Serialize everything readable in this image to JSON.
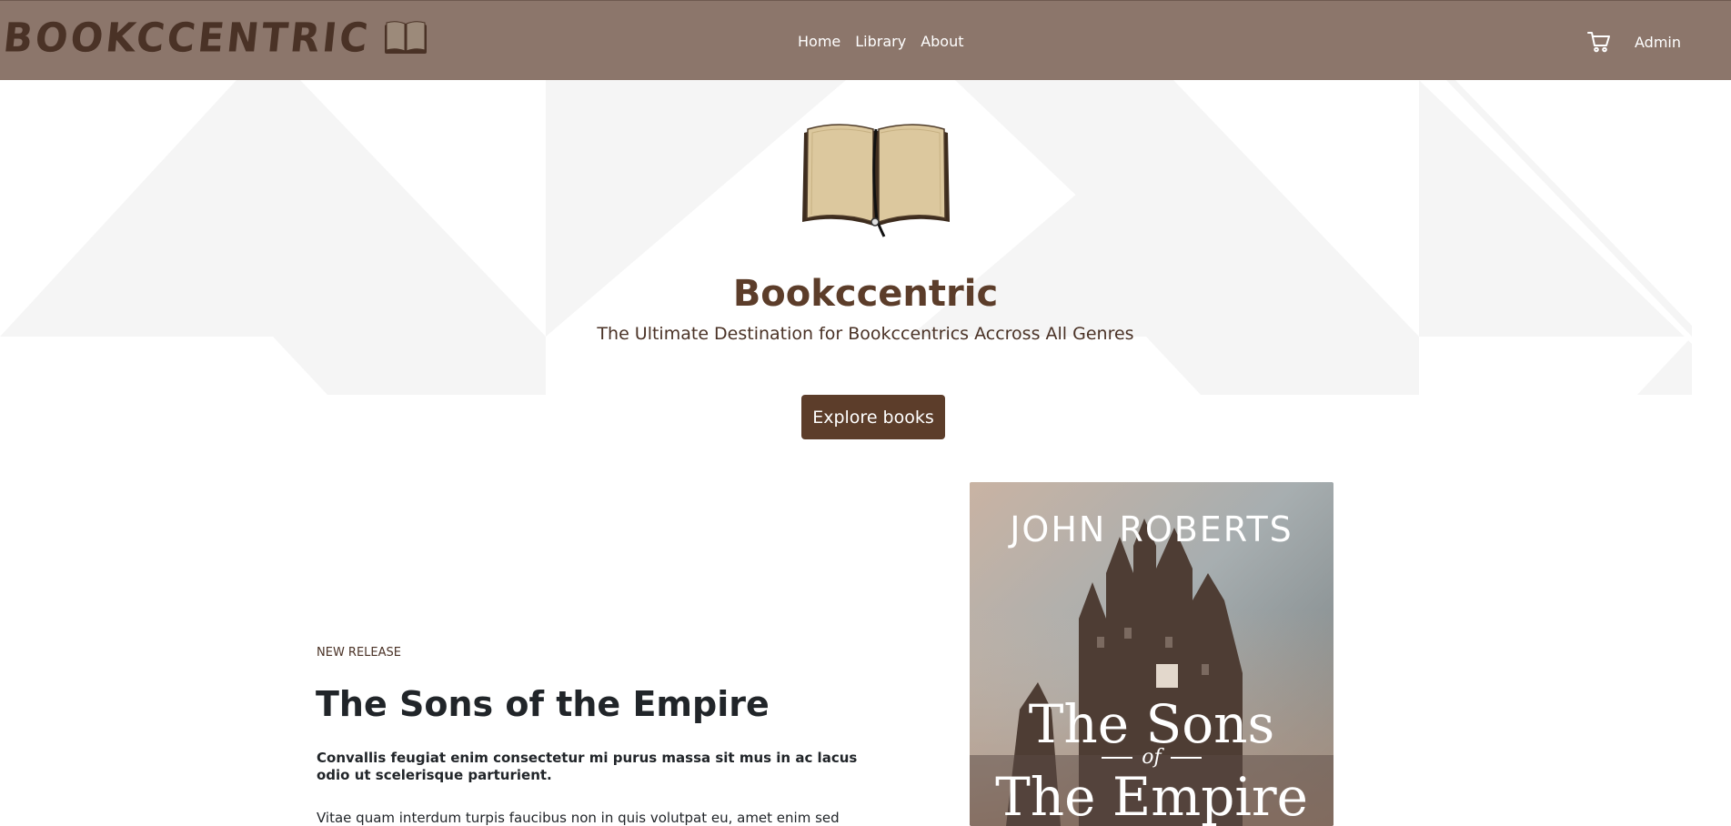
{
  "brand": {
    "name": "BOOKCCENTRIC",
    "icon": "open-book-icon"
  },
  "nav": {
    "links": [
      "Home",
      "Library",
      "About"
    ],
    "cart_icon": "cart-icon",
    "admin": "Admin"
  },
  "hero": {
    "title": "Bookccentric",
    "subtitle": "The Ultimate Destination for Bookccentrics Accross All Genres",
    "cta": "Explore books"
  },
  "featured": {
    "eyebrow": "NEW RELEASE",
    "title": "The Sons of the Empire",
    "lead": "Convallis feugiat enim consectetur mi purus massa sit mus in ac lacus odio ut scelerisque parturient.",
    "body": "Vitae quam interdum turpis faucibus non in quis volutpat eu, amet enim sed mattis",
    "cover": {
      "author": "JOHN ROBERTS",
      "title_line1": "The Sons",
      "title_of": "of",
      "title_line2": "The Empire"
    }
  },
  "colors": {
    "navbar": "#8c766b",
    "brand": "#4a3226",
    "accent": "#5c3d2a"
  }
}
